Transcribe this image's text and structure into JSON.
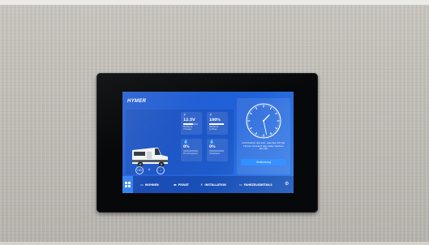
{
  "screen": {
    "brand": "HYMER",
    "stats": [
      {
        "icon": "lightning-icon",
        "value": "12.5V",
        "label": "Batterie Chassis",
        "level": 0.65
      },
      {
        "icon": "lightning-icon",
        "value": "100%",
        "label": "Batterie Aufbau",
        "level": 1.0
      },
      {
        "icon": "drop-icon",
        "value": "0%",
        "label": "Frischwasser",
        "level": 0.0
      },
      {
        "icon": "drop-icon",
        "value": "0%",
        "label": "Abwasser",
        "level": 0.0
      }
    ],
    "quick_buttons": [
      "OD",
      "A",
      "i"
    ],
    "clock": {
      "hour": 1,
      "minute": 28
    },
    "info_text": "Informieren Sie sich, was Sie mit der Hymer Connect App alles machen können",
    "connect_button": "Verbindung",
    "nav": [
      {
        "icon": "sofa-icon",
        "label": "WOHNEN"
      },
      {
        "icon": "bed-icon",
        "label": "PRIVAT"
      },
      {
        "icon": "wrench-icon",
        "label": "INSTALLATION"
      },
      {
        "icon": "car-icon",
        "label": "FAHRZEUGDETAILS"
      }
    ]
  },
  "colors": {
    "screen_blue": "#1f5fd8",
    "accent": "#2c8cff",
    "wall": "#c5c2bc",
    "bezel": "#07080a"
  }
}
